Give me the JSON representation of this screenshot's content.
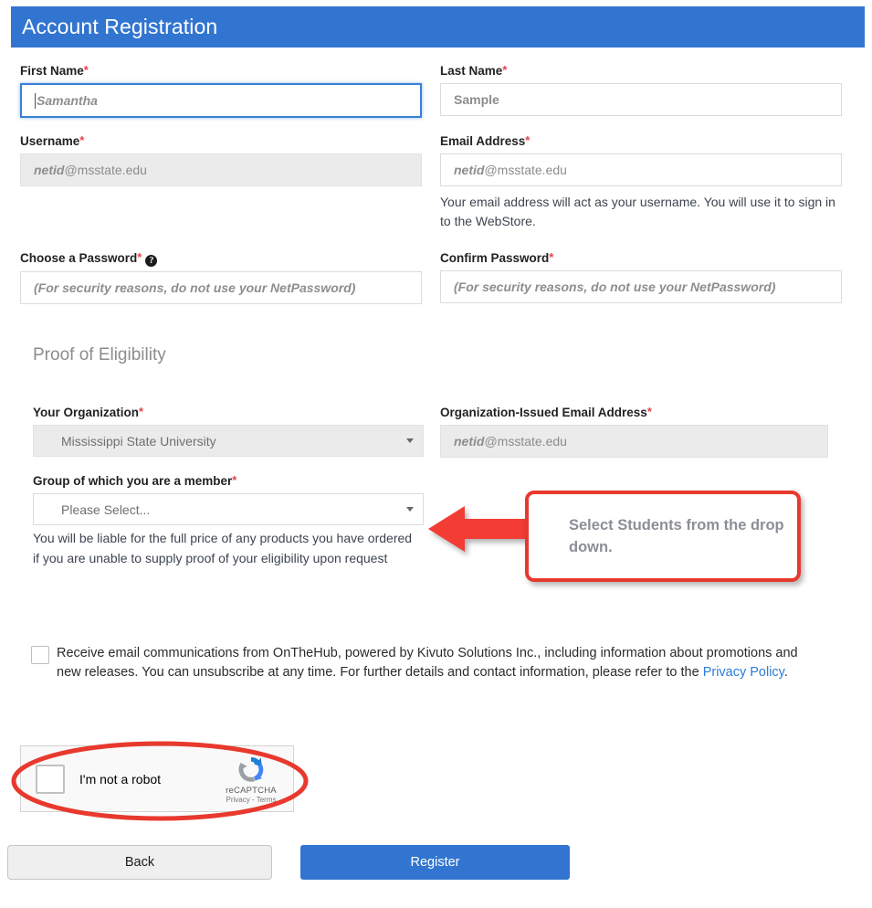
{
  "header": {
    "title": "Account Registration"
  },
  "fields": {
    "first_name": {
      "label": "First Name",
      "required_mark": "*",
      "placeholder": "Samantha",
      "value": ""
    },
    "last_name": {
      "label": "Last Name",
      "required_mark": "*",
      "placeholder": "Sample",
      "value": ""
    },
    "username": {
      "label": "Username",
      "required_mark": "*",
      "placeholder_bold": "netid",
      "placeholder_rest": "@msstate.edu",
      "value": ""
    },
    "email": {
      "label": "Email Address",
      "required_mark": "*",
      "placeholder_bold": "netid",
      "placeholder_rest": "@msstate.edu",
      "value": "",
      "hint": "Your email address will act as your username. You will use it to sign in to the WebStore."
    },
    "password": {
      "label": "Choose a Password",
      "required_mark": "*",
      "help_glyph": "?",
      "placeholder": "(For security reasons, do not use your NetPassword)",
      "value": ""
    },
    "confirm_password": {
      "label": "Confirm Password",
      "required_mark": "*",
      "placeholder": "(For security reasons, do not use your NetPassword)",
      "value": ""
    }
  },
  "eligibility": {
    "section_title": "Proof of Eligibility",
    "organization": {
      "label": "Your Organization",
      "required_mark": "*",
      "value": "Mississippi State University"
    },
    "org_email": {
      "label": "Organization-Issued Email Address",
      "required_mark": "*",
      "placeholder_bold": "netid",
      "placeholder_rest": "@msstate.edu",
      "value": ""
    },
    "group": {
      "label": "Group of which you are a member",
      "required_mark": "*",
      "value": "Please Select...",
      "note": "You will be liable for the full price of any products you have ordered if you are unable to supply proof of your eligibility upon request"
    }
  },
  "annotation": {
    "callout_text": "Select Students from the drop down.",
    "accent_color": "#e8392e"
  },
  "consent": {
    "text_before_link": "Receive email communications from OnTheHub, powered by Kivuto Solutions Inc., including information about promotions and new releases. You can unsubscribe at any time. For further details and contact information, please refer to the ",
    "link_label": "Privacy Policy",
    "text_after_link": ".",
    "checked": false
  },
  "recaptcha": {
    "label": "I'm not a robot",
    "brand": "reCAPTCHA",
    "fine_print": "Privacy - Terms",
    "checked": false
  },
  "buttons": {
    "back": "Back",
    "register": "Register"
  },
  "colors": {
    "header_blue": "#3275d0",
    "primary_button": "#3275d0",
    "required_red": "#e8414a",
    "annotation_red": "#e8392e",
    "link_blue": "#2b7bd6"
  }
}
